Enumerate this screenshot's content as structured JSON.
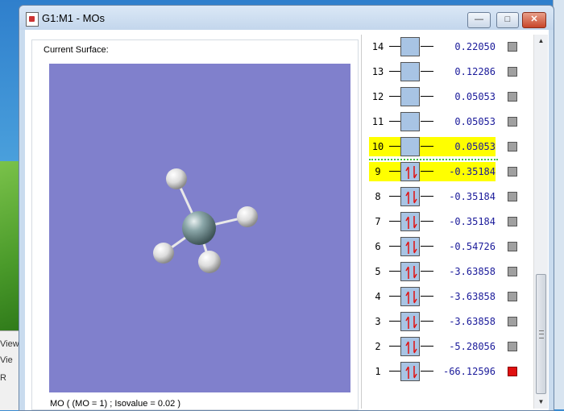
{
  "window": {
    "title": "G1:M1 - MOs",
    "buttons": {
      "minimize": "—",
      "maximize": "□",
      "close": "✕"
    }
  },
  "background_app": {
    "rows": [
      "View",
      "Vie",
      "R",
      ""
    ]
  },
  "surface": {
    "group_label": "Current Surface:",
    "caption": "MO ( (MO = 1) ; Isovalue = 0.02 )",
    "viewport_color": "#8080cc"
  },
  "orbitals": [
    {
      "index": "14",
      "energy": "0.22050",
      "occupied": false,
      "highlight": false,
      "selected": false
    },
    {
      "index": "13",
      "energy": "0.12286",
      "occupied": false,
      "highlight": false,
      "selected": false
    },
    {
      "index": "12",
      "energy": "0.05053",
      "occupied": false,
      "highlight": false,
      "selected": false
    },
    {
      "index": "11",
      "energy": "0.05053",
      "occupied": false,
      "highlight": false,
      "selected": false
    },
    {
      "index": "10",
      "energy": "0.05053",
      "occupied": false,
      "highlight": true,
      "selected": false
    },
    {
      "index": "9",
      "energy": "-0.35184",
      "occupied": true,
      "highlight": true,
      "selected": false
    },
    {
      "index": "8",
      "energy": "-0.35184",
      "occupied": true,
      "highlight": false,
      "selected": false
    },
    {
      "index": "7",
      "energy": "-0.35184",
      "occupied": true,
      "highlight": false,
      "selected": false
    },
    {
      "index": "6",
      "energy": "-0.54726",
      "occupied": true,
      "highlight": false,
      "selected": false
    },
    {
      "index": "5",
      "energy": "-3.63858",
      "occupied": true,
      "highlight": false,
      "selected": false
    },
    {
      "index": "4",
      "energy": "-3.63858",
      "occupied": true,
      "highlight": false,
      "selected": false
    },
    {
      "index": "3",
      "energy": "-3.63858",
      "occupied": true,
      "highlight": false,
      "selected": false
    },
    {
      "index": "2",
      "energy": "-5.28056",
      "occupied": true,
      "highlight": false,
      "selected": false
    },
    {
      "index": "1",
      "energy": "-66.12596",
      "occupied": true,
      "highlight": false,
      "selected": true
    }
  ],
  "colors": {
    "highlight": "#ffff00",
    "energy_text": "#1a1a9a",
    "selected_checkbox": "#e01010",
    "unselected_checkbox": "#a0a0a0",
    "homo_lumo_separator": "#3cbf3c"
  }
}
